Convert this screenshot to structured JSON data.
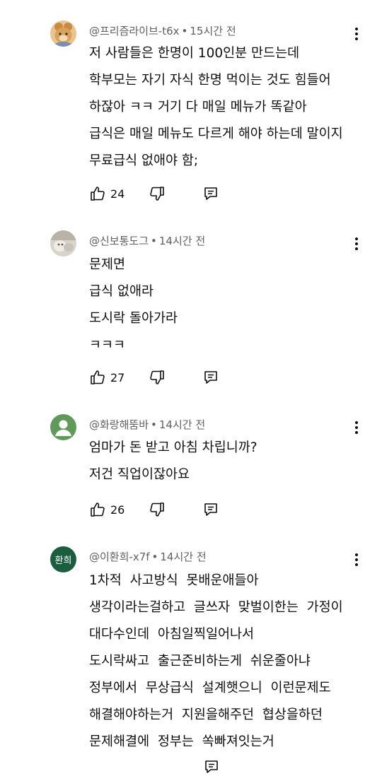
{
  "comments": [
    {
      "author": "@프리즘라이브-t6x",
      "time": "15시간 전",
      "avatar": "bear-photo",
      "lines": [
        "저 사람들은 한명이 100인분 만드는데",
        "학부모는 자기 자식 한명 먹이는 것도 힘들어",
        "하잖아 ㅋㅋ 거기 다 매일 메뉴가 똑같아",
        "급식은 매일 메뉴도 다르게 해야 하는데 말이지",
        "무료급식 없애야 함;"
      ],
      "likes": "24"
    },
    {
      "author": "@신보통도그",
      "time": "14시간 전",
      "avatar": "photo",
      "lines": [
        "문제면",
        "급식 없애라",
        "도시락 돌아가라",
        "ㅋㅋㅋ"
      ],
      "likes": "27"
    },
    {
      "author": "@화랑해뚬바",
      "time": "14시간 전",
      "avatar": "default-person",
      "lines": [
        "엄마가 돈 받고 아침 차립니까?",
        "저건 직업이잖아요"
      ],
      "likes": "26"
    },
    {
      "author": "@이환희-x7f",
      "time": "14시간 전",
      "avatar": "initials",
      "avatar_text": "환희",
      "lines": [
        "1차적  사고방식  못배운애들아",
        "생각이라는걸하고  글쓰자  맞벌이한는  가정이",
        "대다수인데  아침일찍일어나서",
        "도시락싸고  출근준비하는게  쉬운줄아냐",
        "정부에서  무상급식  설계햇으니  이런문제도",
        "해결해야하는거  지원을해주던  협상을하던",
        "문제해결에  정부는  쏙빠져잇는거"
      ],
      "likes": ""
    }
  ],
  "colors": {
    "text": "#0f0f0f",
    "meta": "#606060",
    "default_avatar_bg": "#5f9a5b",
    "initials_avatar_bg": "#1b5e3f"
  },
  "icons": {
    "like": "thumb-up-icon",
    "dislike": "thumb-down-icon",
    "reply": "reply-comment-icon",
    "more": "more-vertical-icon"
  }
}
